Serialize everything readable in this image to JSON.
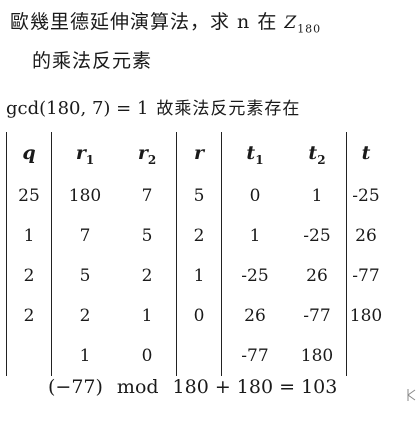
{
  "title": {
    "line1": "歐幾里德延伸演算法，求 n 在",
    "z_symbol": "Z",
    "z_sub": "180",
    "line2": "的乘法反元素"
  },
  "gcd_line": {
    "math": "gcd(180, 7) = 1",
    "text": "故乘法反元素存在"
  },
  "table": {
    "headers": [
      {
        "sym": "q",
        "sub": ""
      },
      {
        "sym": "r",
        "sub": "1"
      },
      {
        "sym": "r",
        "sub": "2"
      },
      {
        "sym": "r",
        "sub": ""
      },
      {
        "sym": "t",
        "sub": "1"
      },
      {
        "sym": "t",
        "sub": "2"
      },
      {
        "sym": "t",
        "sub": ""
      }
    ],
    "rows": [
      [
        "25",
        "180",
        "7",
        "5",
        "0",
        "1",
        "-25"
      ],
      [
        "1",
        "7",
        "5",
        "2",
        "1",
        "-25",
        "26"
      ],
      [
        "2",
        "5",
        "2",
        "1",
        "-25",
        "26",
        "-77"
      ],
      [
        "2",
        "2",
        "1",
        "0",
        "26",
        "-77",
        "180"
      ],
      [
        "",
        "1",
        "0",
        "",
        "-77",
        "180",
        ""
      ]
    ]
  },
  "formula": {
    "left": "(−77)",
    "mod": "mod",
    "right": "180 + 180 = 103"
  }
}
